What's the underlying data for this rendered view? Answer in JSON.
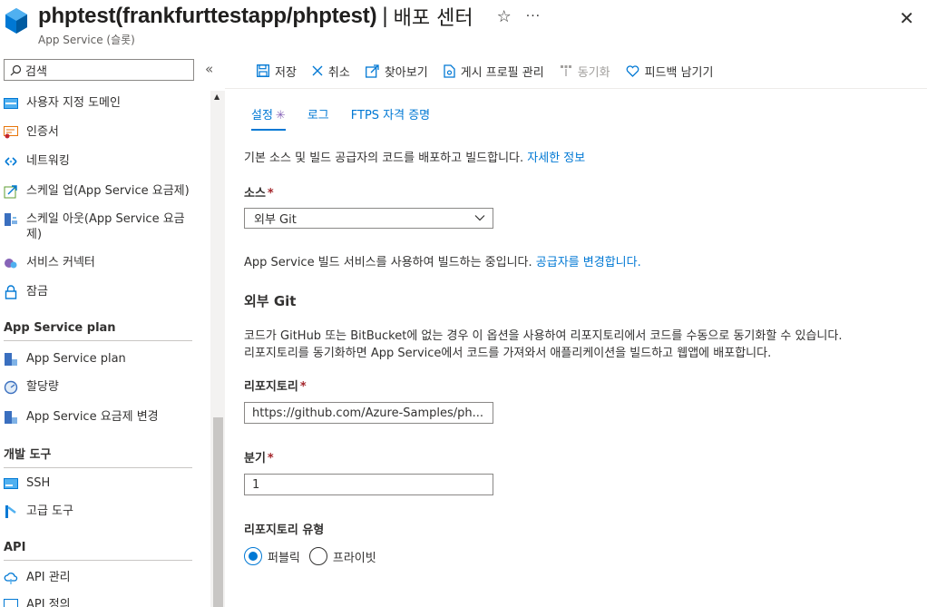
{
  "header": {
    "title": "phptest(frankfurttestapp/phptest)",
    "separator": "|",
    "section": "배포 센터",
    "subtitle": "App Service (슬롯)",
    "star_icon": "star-icon",
    "more_icon": "more-icon",
    "close_icon": "close-icon"
  },
  "sidebar": {
    "search_placeholder": "검색",
    "collapse_glyph": "«",
    "items": [
      {
        "label": "사용자 지정 도메인",
        "icon": "custom-domain-icon"
      },
      {
        "label": "인증서",
        "icon": "certificate-icon"
      },
      {
        "label": "네트워킹",
        "icon": "networking-icon"
      },
      {
        "label": "스케일 업(App Service 요금제)",
        "icon": "scale-up-icon"
      },
      {
        "label": "스케일 아웃(App Service 요금제)",
        "icon": "scale-out-icon"
      },
      {
        "label": "서비스 커넥터",
        "icon": "service-connector-icon"
      },
      {
        "label": "잠금",
        "icon": "lock-icon"
      }
    ],
    "sections": [
      {
        "title": "App Service plan",
        "items": [
          {
            "label": "App Service plan",
            "icon": "app-service-plan-icon"
          },
          {
            "label": "할당량",
            "icon": "quota-icon"
          },
          {
            "label": "App Service 요금제 변경",
            "icon": "change-plan-icon"
          }
        ]
      },
      {
        "title": "개발 도구",
        "items": [
          {
            "label": "SSH",
            "icon": "ssh-icon"
          },
          {
            "label": "고급 도구",
            "icon": "advanced-tools-icon"
          }
        ]
      },
      {
        "title": "API",
        "items": [
          {
            "label": "API 관리",
            "icon": "api-management-icon"
          },
          {
            "label": "API 정의",
            "icon": "api-definition-icon"
          }
        ]
      }
    ]
  },
  "toolbar": {
    "save": "저장",
    "cancel": "취소",
    "browse": "찾아보기",
    "manage_publish_profile": "게시 프로필 관리",
    "sync": "동기화",
    "feedback": "피드백 남기기"
  },
  "tabs": {
    "settings": "설정",
    "settings_dirty": "✳",
    "logs": "로그",
    "ftps": "FTPS 자격 증명"
  },
  "main": {
    "intro": "기본 소스 및 빌드 공급자의 코드를 배포하고 빌드합니다.",
    "intro_link": "자세한 정보",
    "source_label": "소스",
    "source_value": "외부 Git",
    "build_text": "App Service 빌드 서비스를 사용하여 빌드하는 중입니다.",
    "build_link": "공급자를 변경합니다.",
    "external_git_title": "외부 Git",
    "external_git_desc_1": "코드가 GitHub 또는 BitBucket에 없는 경우 이 옵션을 사용하여 리포지토리에서 코드를 수동으로 동기화할 수 있습니다.",
    "external_git_desc_2": "리포지토리를 동기화하면 App Service에서 코드를 가져와서 애플리케이션을 빌드하고 웹앱에 배포합니다.",
    "repo_label": "리포지토리",
    "repo_value": "https://github.com/Azure-Samples/ph...",
    "branch_label": "분기",
    "branch_value": "1",
    "repo_type_label": "리포지토리 유형",
    "public_label": "퍼블릭",
    "private_label": "프라이빗",
    "required_marker": "*"
  },
  "colors": {
    "accent": "#0078d4",
    "required": "#a4262c",
    "dirty": "#8764b8"
  }
}
